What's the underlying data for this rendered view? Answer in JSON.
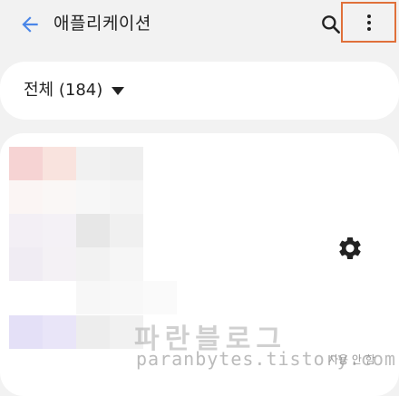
{
  "header": {
    "title": "애플리케이션",
    "back_icon": "arrow-left-icon",
    "search_icon": "search-icon",
    "more_icon": "more-vert-icon",
    "highlight_color": "#e0703a"
  },
  "filter": {
    "label": "전체 (184)",
    "dropdown_icon": "caret-down-icon"
  },
  "app_item": {
    "settings_icon": "gear-icon",
    "status": "사용 안 함"
  },
  "watermark": {
    "text": "파란블로그",
    "url": "paranbytes.tistory.com"
  },
  "colors": {
    "background": "#f2f2f2",
    "card": "#ffffff",
    "accent": "#4a86e8"
  }
}
